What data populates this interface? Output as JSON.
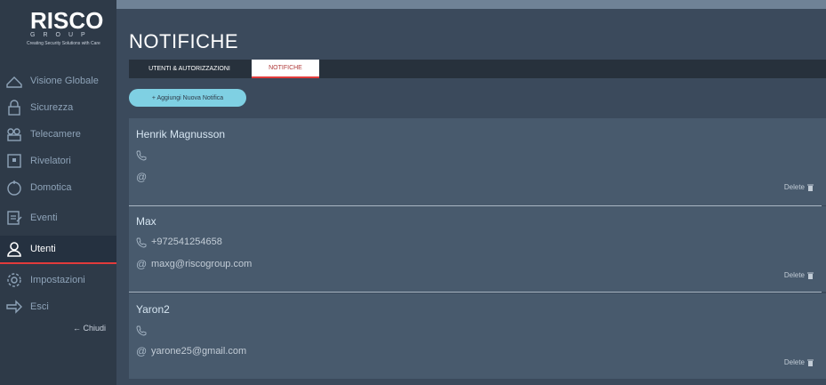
{
  "brand": {
    "logo_main": "RISCO",
    "logo_group": "GROUP",
    "tagline": "Creating Security Solutions with Care"
  },
  "sidebar": {
    "items": [
      {
        "label": "Visione Globale",
        "icon": "house-icon"
      },
      {
        "label": "Sicurezza",
        "icon": "lock-icon"
      },
      {
        "label": "Telecamere",
        "icon": "camera-icon"
      },
      {
        "label": "Rivelatori",
        "icon": "detector-icon"
      },
      {
        "label": "Domotica",
        "icon": "automation-icon"
      },
      {
        "label": "Eventi",
        "icon": "events-icon"
      },
      {
        "label": "Utenti",
        "icon": "user-icon",
        "active": true
      },
      {
        "label": "Impostazioni",
        "icon": "gear-icon"
      },
      {
        "label": "Esci",
        "icon": "exit-icon"
      }
    ],
    "close_label": "← Chiudi"
  },
  "header": {
    "title": "NOTIFICHE"
  },
  "tabs": [
    {
      "label": "UTENTI & AUTORIZZAZIONI"
    },
    {
      "label": "NOTIFICHE",
      "active": true
    }
  ],
  "add_button_label": "+ Aggiungi Nuova Notifica",
  "notifications": [
    {
      "name": "Henrik Magnusson",
      "phone": "",
      "email": "",
      "delete_label": "Delete"
    },
    {
      "name": "Max",
      "phone": "+972541254658",
      "email": "maxg@riscogroup.com",
      "delete_label": "Delete"
    },
    {
      "name": "Yaron2",
      "phone": "",
      "email": "yarone25@gmail.com",
      "delete_label": "Delete"
    }
  ],
  "colors": {
    "accent": "#e23b3b",
    "button": "#7fd0e3",
    "sidebar": "#2e3a48",
    "card": "#485a6d"
  }
}
